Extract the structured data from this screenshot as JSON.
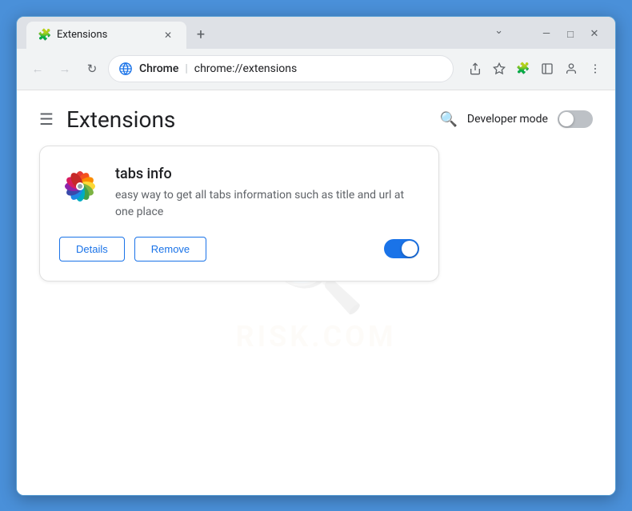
{
  "window": {
    "title": "Extensions",
    "tab_title": "Extensions",
    "controls": {
      "minimize": "—",
      "maximize": "□",
      "close": "✕",
      "dropdown": "⌄"
    }
  },
  "address_bar": {
    "brand": "Chrome",
    "separator": "|",
    "url": "chrome://extensions",
    "nav": {
      "back": "←",
      "forward": "→",
      "reload": "↻"
    }
  },
  "extensions_page": {
    "title": "Extensions",
    "hamburger": "☰",
    "search_icon": "🔍",
    "developer_mode_label": "Developer mode",
    "cards": [
      {
        "name": "tabs info",
        "description": "easy way to get all tabs information such as title and url at one place",
        "enabled": true,
        "buttons": [
          {
            "label": "Details"
          },
          {
            "label": "Remove"
          }
        ]
      }
    ]
  },
  "watermark": {
    "text": "RISK.COM"
  }
}
